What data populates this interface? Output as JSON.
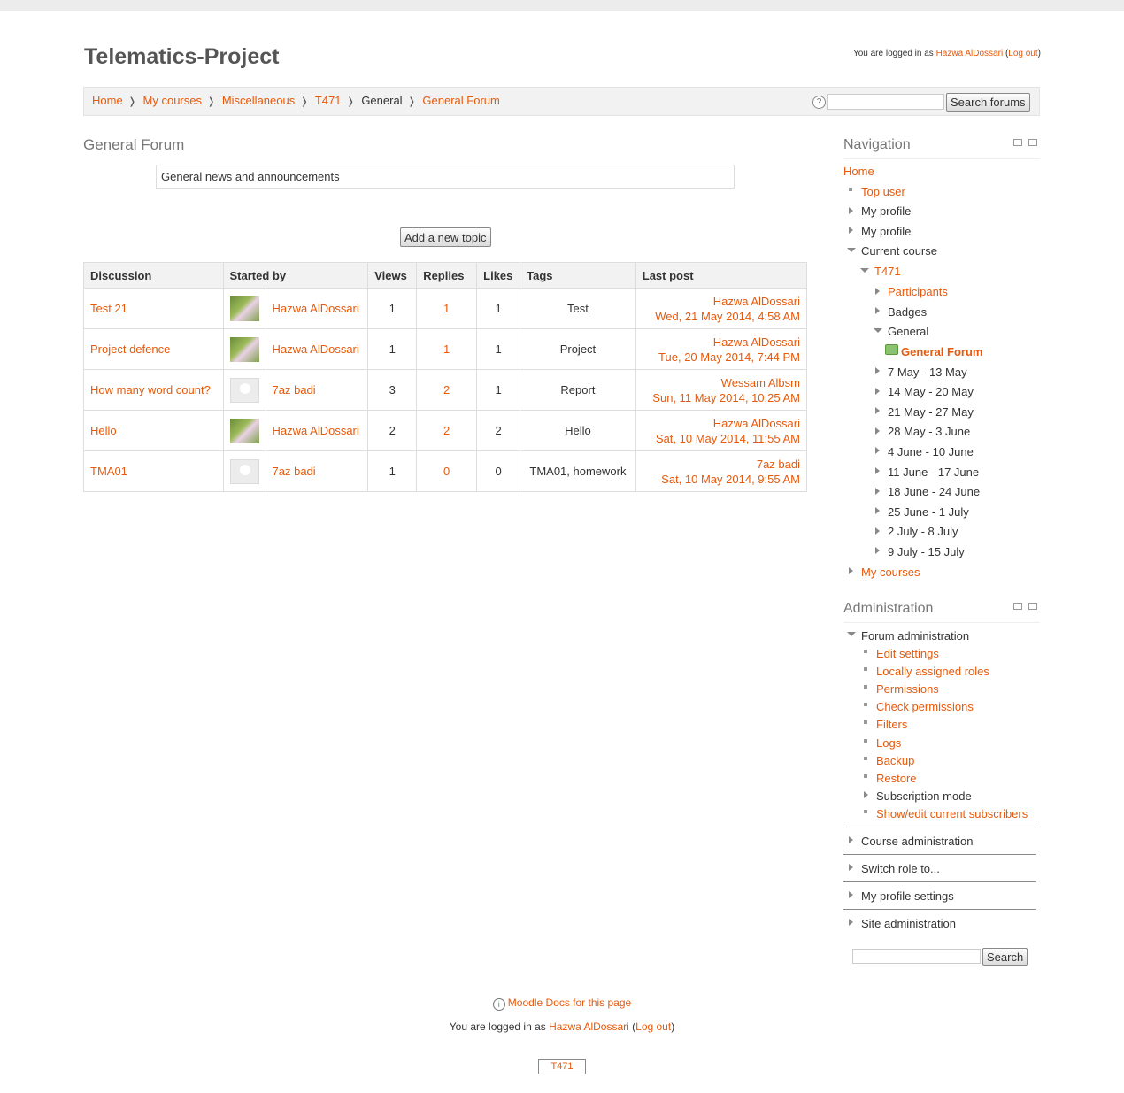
{
  "header": {
    "site_title": "Telematics-Project",
    "login_prefix": "You are logged in as",
    "user_name": "Hazwa AlDossari",
    "logout_label": "Log out"
  },
  "breadcrumb": {
    "items": [
      "Home",
      "My courses",
      "Miscellaneous",
      "T471",
      "General",
      "General Forum"
    ],
    "search_button": "Search forums"
  },
  "forum": {
    "heading": "General Forum",
    "intro": "General news and announcements",
    "add_topic_label": "Add a new topic",
    "columns": [
      "Discussion",
      "Started by",
      "Views",
      "Replies",
      "Likes",
      "Tags",
      "Last post"
    ],
    "rows": [
      {
        "discussion": "Test 21",
        "started_by": "Hazwa AlDossari",
        "views": "1",
        "replies": "1",
        "likes": "1",
        "tags": "Test",
        "last_user": "Hazwa AlDossari",
        "last_date": "Wed, 21 May 2014, 4:58 AM",
        "pic": "photo"
      },
      {
        "discussion": "Project defence",
        "started_by": "Hazwa AlDossari",
        "views": "1",
        "replies": "1",
        "likes": "1",
        "tags": "Project",
        "last_user": "Hazwa AlDossari",
        "last_date": "Tue, 20 May 2014, 7:44 PM",
        "pic": "photo"
      },
      {
        "discussion": "How many word count?",
        "started_by": "7az badi",
        "views": "3",
        "replies": "2",
        "likes": "1",
        "tags": "Report",
        "last_user": "Wessam Albsm",
        "last_date": "Sun, 11 May 2014, 10:25 AM",
        "pic": "blank"
      },
      {
        "discussion": "Hello",
        "started_by": "Hazwa AlDossari",
        "views": "2",
        "replies": "2",
        "likes": "2",
        "tags": "Hello",
        "last_user": "Hazwa AlDossari",
        "last_date": "Sat, 10 May 2014, 11:55 AM",
        "pic": "photo"
      },
      {
        "discussion": "TMA01",
        "started_by": "7az badi",
        "views": "1",
        "replies": "0",
        "likes": "0",
        "tags": "TMA01, homework",
        "last_user": "7az badi",
        "last_date": "Sat, 10 May 2014, 9:55 AM",
        "pic": "blank"
      }
    ]
  },
  "navigation": {
    "title": "Navigation",
    "home": "Home",
    "top_user": "Top user",
    "my_profile_1": "My profile",
    "my_profile_2": "My profile",
    "current_course": "Current course",
    "course": "T471",
    "participants": "Participants",
    "badges": "Badges",
    "general": "General",
    "general_forum": "General Forum",
    "weeks": [
      "7 May - 13 May",
      "14 May - 20 May",
      "21 May - 27 May",
      "28 May - 3 June",
      "4 June - 10 June",
      "11 June - 17 June",
      "18 June - 24 June",
      "25 June - 1 July",
      "2 July - 8 July",
      "9 July - 15 July"
    ],
    "my_courses": "My courses"
  },
  "administration": {
    "title": "Administration",
    "forum_admin": "Forum administration",
    "forum_items": [
      "Edit settings",
      "Locally assigned roles",
      "Permissions",
      "Check permissions",
      "Filters",
      "Logs",
      "Backup",
      "Restore"
    ],
    "subscription_mode": "Subscription mode",
    "subscribers": "Show/edit current subscribers",
    "course_admin": "Course administration",
    "switch_role": "Switch role to...",
    "profile_settings": "My profile settings",
    "site_admin": "Site administration",
    "search_button": "Search"
  },
  "footer": {
    "docs_link": "Moodle Docs for this page",
    "login_prefix": "You are logged in as",
    "user_name": "Hazwa AlDossari",
    "logout_label": "Log out",
    "course_button": "T471"
  },
  "colors": {
    "link": "#e65a0d",
    "text": "#333333",
    "bar": "#f2f2f2"
  }
}
